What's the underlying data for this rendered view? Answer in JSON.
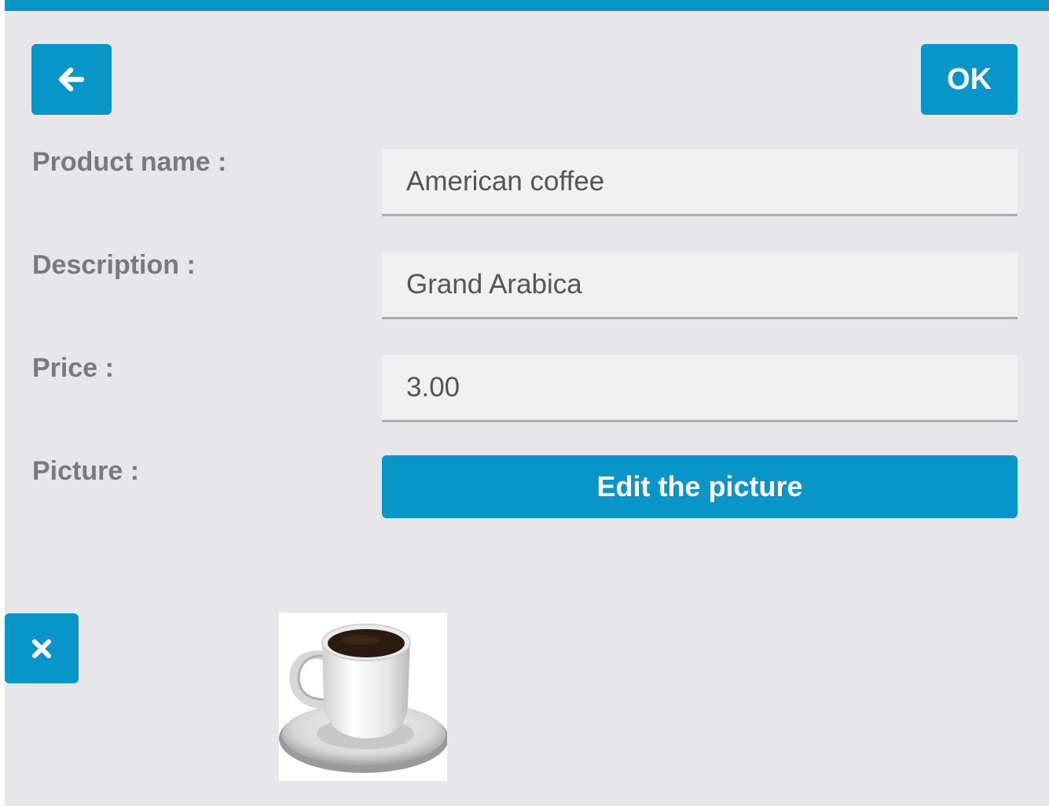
{
  "colors": {
    "accent": "#0895c8",
    "background": "#e7e6ea",
    "field_background": "#f1f1f1",
    "label_text": "#7a7a7a"
  },
  "header": {
    "back_icon": "arrow-left-icon",
    "ok_label": "OK"
  },
  "form": {
    "product_name": {
      "label": "Product name :",
      "value": "American coffee"
    },
    "description": {
      "label": "Description :",
      "value": "Grand Arabica"
    },
    "price": {
      "label": "Price :",
      "value": "3.00"
    },
    "picture": {
      "label": "Picture :",
      "edit_label": "Edit the picture"
    }
  },
  "picture_preview": {
    "remove_icon": "close-icon",
    "image_subject": "coffee-cup-icon"
  }
}
